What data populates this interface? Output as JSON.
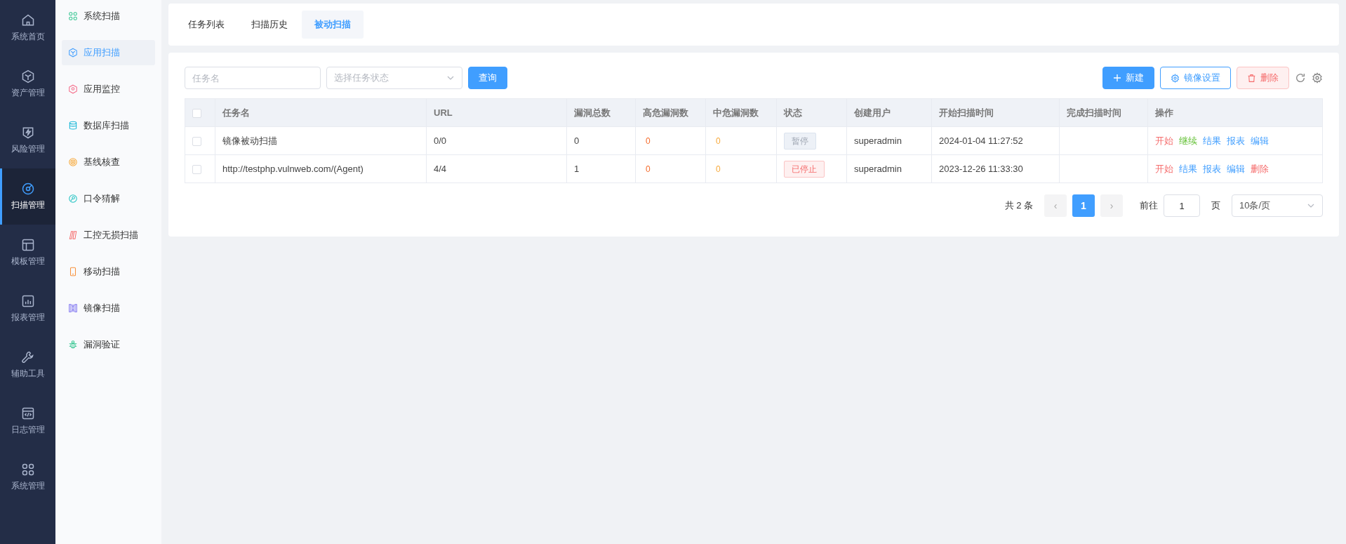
{
  "rail": [
    {
      "label": "系统首页",
      "selected": false
    },
    {
      "label": "资产管理",
      "selected": false
    },
    {
      "label": "风险管理",
      "selected": false
    },
    {
      "label": "扫描管理",
      "selected": true
    },
    {
      "label": "模板管理",
      "selected": false
    },
    {
      "label": "报表管理",
      "selected": false
    },
    {
      "label": "辅助工具",
      "selected": false
    },
    {
      "label": "日志管理",
      "selected": false
    },
    {
      "label": "系统管理",
      "selected": false
    }
  ],
  "submenu": [
    {
      "label": "系统扫描",
      "selected": false
    },
    {
      "label": "应用扫描",
      "selected": true
    },
    {
      "label": "应用监控",
      "selected": false
    },
    {
      "label": "数据库扫描",
      "selected": false
    },
    {
      "label": "基线核查",
      "selected": false
    },
    {
      "label": "口令猜解",
      "selected": false
    },
    {
      "label": "工控无损扫描",
      "selected": false
    },
    {
      "label": "移动扫描",
      "selected": false
    },
    {
      "label": "镜像扫描",
      "selected": false
    },
    {
      "label": "漏洞验证",
      "selected": false
    }
  ],
  "tabs": [
    {
      "label": "任务列表",
      "selected": false
    },
    {
      "label": "扫描历史",
      "selected": false
    },
    {
      "label": "被动扫描",
      "selected": true
    }
  ],
  "filters": {
    "name_placeholder": "任务名",
    "status_placeholder": "选择任务状态",
    "query_button": "查询"
  },
  "toolbar": [
    {
      "label": "新建",
      "kind": "primary"
    },
    {
      "label": "镜像设置",
      "kind": "outline"
    },
    {
      "label": "删除",
      "kind": "danger"
    }
  ],
  "table": {
    "select_all_checked": false,
    "columns": [
      "任务名",
      "URL",
      "漏洞总数",
      "高危漏洞数",
      "中危漏洞数",
      "状态",
      "创建用户",
      "开始扫描时间",
      "完成扫描时间",
      "操作"
    ],
    "rows": [
      {
        "checked": false,
        "name": "镜像被动扫描",
        "url": "0/0",
        "total": "0",
        "high": "0",
        "medium": "0",
        "status": {
          "label": "暂停",
          "kind": "paused"
        },
        "user": "superadmin",
        "start": "2024-01-04 11:27:52",
        "actions": [
          {
            "label": "开始",
            "kind": "danger"
          },
          {
            "label": "继续",
            "kind": "success"
          },
          {
            "label": "结果",
            "kind": "primary"
          },
          {
            "label": "报表",
            "kind": "primary"
          },
          {
            "label": "编辑",
            "kind": "primary"
          }
        ]
      },
      {
        "checked": false,
        "name": "http://testphp.vulnweb.com/(Agent)",
        "url": "4/4",
        "total": "1",
        "high": "0",
        "medium": "0",
        "status": {
          "label": "已停止",
          "kind": "stopped"
        },
        "user": "superadmin",
        "start": "2023-12-26 11:33:30",
        "actions": [
          {
            "label": "开始",
            "kind": "danger"
          },
          {
            "label": "结果",
            "kind": "primary"
          },
          {
            "label": "报表",
            "kind": "primary"
          },
          {
            "label": "编辑",
            "kind": "primary"
          },
          {
            "label": "删除",
            "kind": "danger"
          }
        ]
      }
    ]
  },
  "pagination": {
    "total": "共 2 条",
    "prev": "‹",
    "pages": [
      {
        "label": "1",
        "selected": true
      }
    ],
    "next": "›",
    "goto_label": "前往",
    "goto_value": "1",
    "page_unit": "页",
    "page_size": "10条/页"
  }
}
